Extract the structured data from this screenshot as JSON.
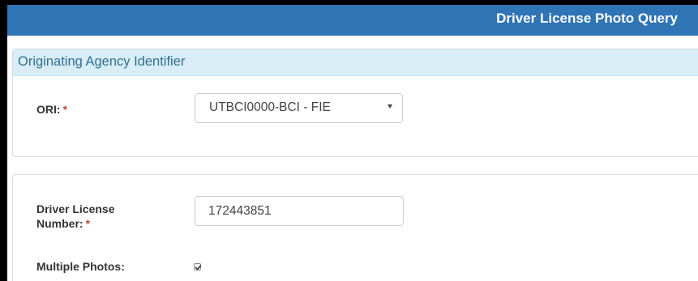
{
  "header": {
    "title": "Driver License Photo Query"
  },
  "agency_panel": {
    "heading": "Originating Agency Identifier",
    "ori_label": "ORI:",
    "required_mark": "*",
    "ori_selected": "UTBCI0000-BCI - FIE"
  },
  "query_panel": {
    "dl_label_line1": "Driver License",
    "dl_label_line2": "Number:",
    "required_mark": "*",
    "dl_value": "172443851",
    "multiple_photos_label": "Multiple Photos:",
    "multiple_photos_checked": true
  },
  "icons": {
    "select_caret": "caret-down-icon",
    "checkbox_check": "check-icon"
  },
  "colors": {
    "header_bg": "#2f74b5",
    "panel_heading_bg": "#d9edf7",
    "panel_heading_text": "#31708f",
    "required": "#b94a48"
  }
}
